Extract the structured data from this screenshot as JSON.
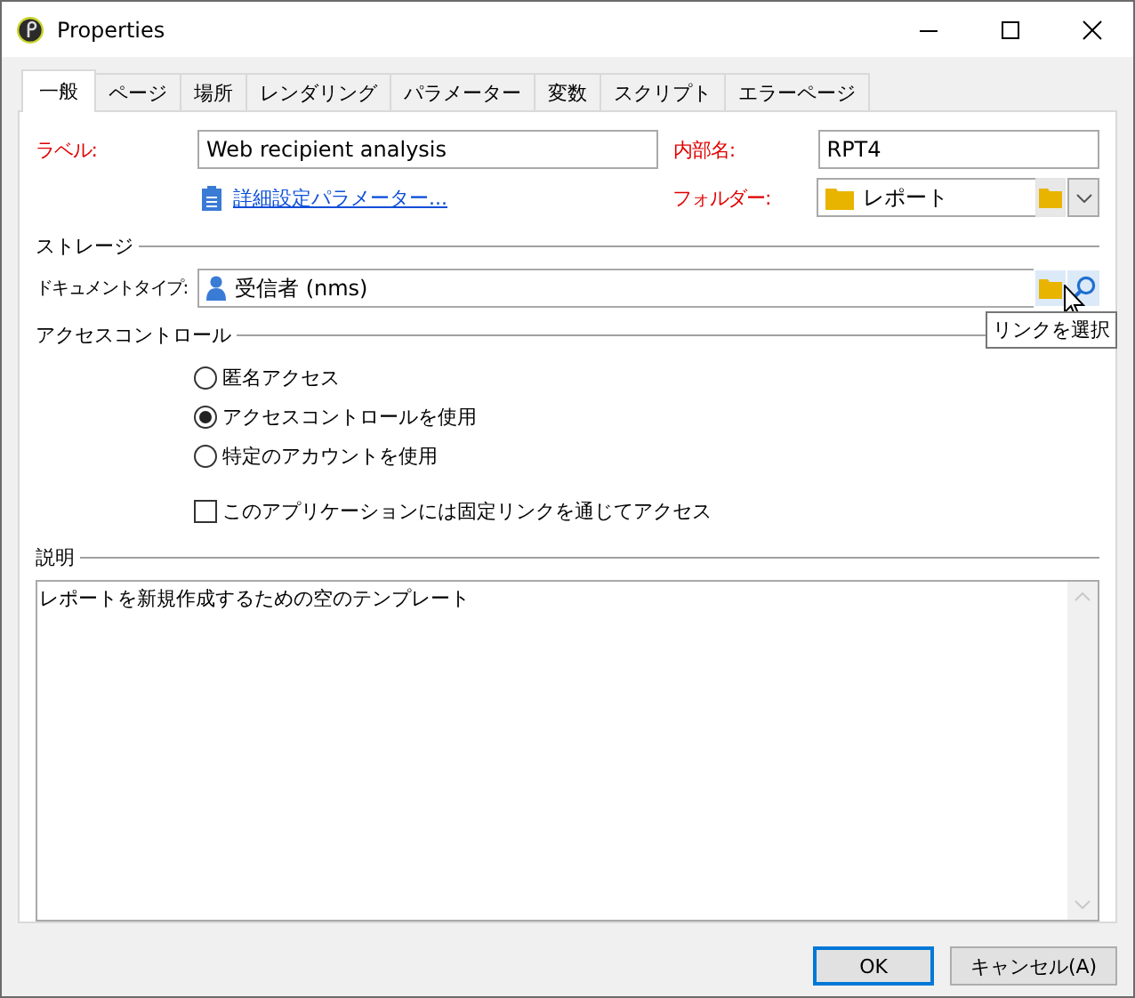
{
  "window": {
    "title": "Properties"
  },
  "tabs": [
    {
      "label": "一般",
      "selected": true
    },
    {
      "label": "ページ",
      "selected": false
    },
    {
      "label": "場所",
      "selected": false
    },
    {
      "label": "レンダリング",
      "selected": false
    },
    {
      "label": "パラメーター",
      "selected": false
    },
    {
      "label": "変数",
      "selected": false
    },
    {
      "label": "スクリプト",
      "selected": false
    },
    {
      "label": "エラーページ",
      "selected": false
    }
  ],
  "general": {
    "label_caption": "ラベル:",
    "label_value": "Web recipient analysis",
    "internal_name_caption": "内部名:",
    "internal_name_value": "RPT4",
    "advanced_link": "詳細設定パラメーター...",
    "folder_caption": "フォルダー:",
    "folder_value": "レポート"
  },
  "storage": {
    "heading": "ストレージ",
    "document_type_caption": "ドキュメントタイプ:",
    "document_type_value": "受信者 (nms)",
    "tooltip": "リンクを選択"
  },
  "access_control": {
    "heading": "アクセスコントロール",
    "options": [
      {
        "label": "匿名アクセス",
        "selected": false
      },
      {
        "label": "アクセスコントロールを使用",
        "selected": true
      },
      {
        "label": "特定のアカウントを使用",
        "selected": false
      }
    ],
    "fixed_link": {
      "label": "このアプリケーションには固定リンクを通じてアクセス",
      "checked": false
    }
  },
  "description": {
    "heading": "説明",
    "text": "レポートを新規作成するための空のテンプレート"
  },
  "buttons": [
    {
      "label": "OK",
      "default": true
    },
    {
      "label": "キャンセル(A)",
      "default": false
    }
  ]
}
